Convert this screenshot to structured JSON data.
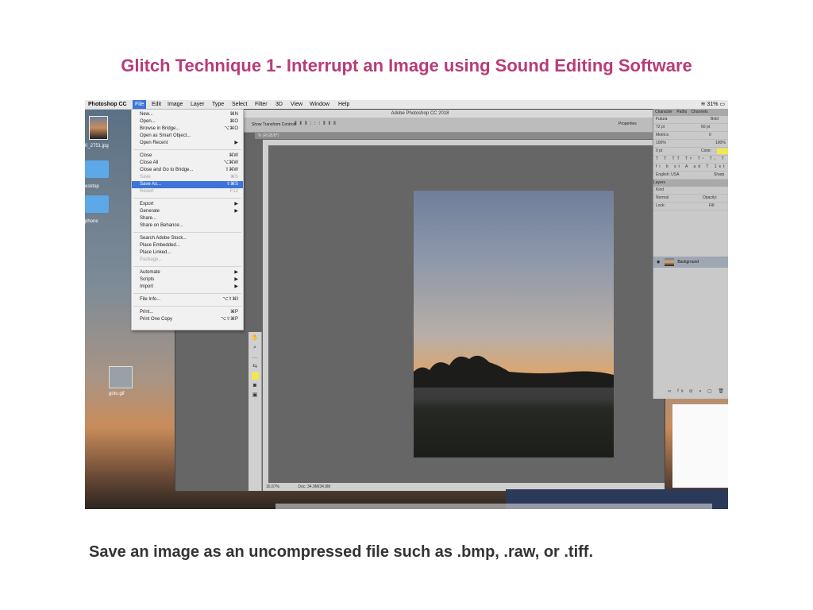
{
  "slide": {
    "title": "Glitch Technique 1- Interrupt an Image using Sound Editing Software",
    "caption": "Save an image as an uncompressed file such as .bmp, .raw, or .tiff."
  },
  "menubar": {
    "app": "Photoshop CC",
    "items": [
      "File",
      "Edit",
      "Image",
      "Layer",
      "Type",
      "Select",
      "Filter",
      "3D",
      "View",
      "Window",
      "Help"
    ],
    "battery": "31%"
  },
  "desktop": {
    "icons": [
      "0_2751.jpg",
      "esktop",
      "phone",
      "gotu.gif"
    ]
  },
  "photoshop": {
    "window_title": "Adobe Photoshop CC 2018",
    "options_bar_label": "Show Transform Controls",
    "doc_tab": "% (RGB/8*)",
    "properties_label": "Properties",
    "status_zoom": "16.67%",
    "status_doc": "Doc: 34.9M/34.9M",
    "panels": {
      "tabs": [
        "Character",
        "Paths",
        "Channels"
      ],
      "font": "Futura",
      "weight": "Bold",
      "size": "72 pt",
      "leading": "60 pt",
      "kerning": "Metrics",
      "tracking": "0",
      "vscale": "100%",
      "hscale": "100%",
      "baseline": "0 pt",
      "color_label": "Color:",
      "language": "English: USA",
      "aa": "Sharp",
      "layers_tab": "Layers",
      "kind": "Kind",
      "blend": "Normal",
      "opacity": "Opacity:",
      "lock": "Lock:",
      "fill": "Fill:",
      "layer_name": "Background"
    }
  },
  "file_menu": [
    {
      "label": "New...",
      "shortcut": "⌘N"
    },
    {
      "label": "Open...",
      "shortcut": "⌘O"
    },
    {
      "label": "Browse in Bridge...",
      "shortcut": "⌥⌘O"
    },
    {
      "label": "Open as Smart Object...",
      "shortcut": ""
    },
    {
      "label": "Open Recent",
      "shortcut": "▶"
    },
    {
      "label": "Close",
      "shortcut": "⌘W"
    },
    {
      "label": "Close All",
      "shortcut": "⌥⌘W"
    },
    {
      "label": "Close and Go to Bridge...",
      "shortcut": "⇧⌘W"
    },
    {
      "label": "Save",
      "shortcut": "⌘S"
    },
    {
      "label": "Save As...",
      "shortcut": "⇧⌘S"
    },
    {
      "label": "Revert",
      "shortcut": "F12"
    },
    {
      "label": "Export",
      "shortcut": "▶"
    },
    {
      "label": "Generate",
      "shortcut": "▶"
    },
    {
      "label": "Share...",
      "shortcut": ""
    },
    {
      "label": "Share on Behance...",
      "shortcut": ""
    },
    {
      "label": "Search Adobe Stock...",
      "shortcut": ""
    },
    {
      "label": "Place Embedded...",
      "shortcut": ""
    },
    {
      "label": "Place Linked...",
      "shortcut": ""
    },
    {
      "label": "Package...",
      "shortcut": ""
    },
    {
      "label": "Automate",
      "shortcut": "▶"
    },
    {
      "label": "Scripts",
      "shortcut": "▶"
    },
    {
      "label": "Import",
      "shortcut": "▶"
    },
    {
      "label": "File Info...",
      "shortcut": "⌥⇧⌘I"
    },
    {
      "label": "Print...",
      "shortcut": "⌘P"
    },
    {
      "label": "Print One Copy",
      "shortcut": "⌥⇧⌘P"
    }
  ]
}
